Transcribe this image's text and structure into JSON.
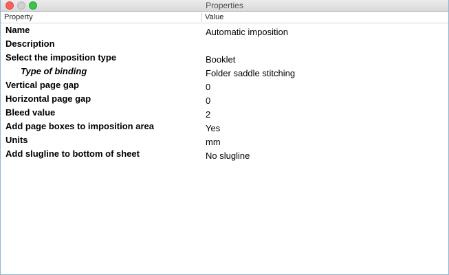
{
  "window": {
    "title": "Properties"
  },
  "header": {
    "property_label": "Property",
    "value_label": "Value"
  },
  "rows": [
    {
      "name": "Name",
      "value": "Automatic imposition"
    },
    {
      "name": "Description",
      "value": ""
    },
    {
      "name": "Select the imposition type",
      "value": "Booklet"
    },
    {
      "name": "Type of binding",
      "value": "Folder saddle stitching"
    },
    {
      "name": "Vertical page gap",
      "value": "0"
    },
    {
      "name": "Horizontal page gap",
      "value": "0"
    },
    {
      "name": "Bleed value",
      "value": "2"
    },
    {
      "name": "Add page boxes to imposition area",
      "value": "Yes"
    },
    {
      "name": "Units",
      "value": "mm"
    },
    {
      "name": "Add slugline to bottom of sheet",
      "value": "No slugline"
    }
  ]
}
